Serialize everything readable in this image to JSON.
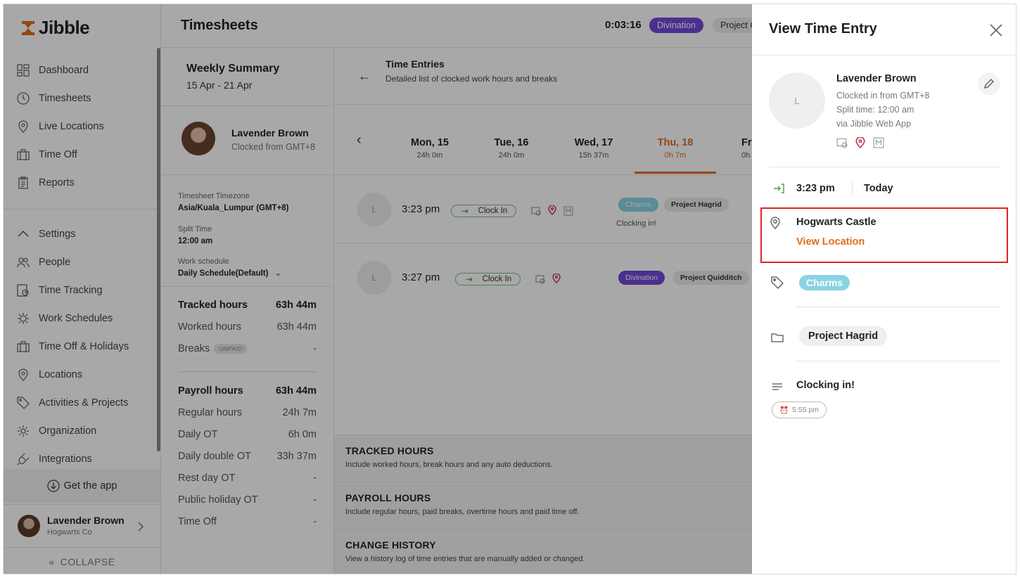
{
  "brand": {
    "name": "Jibble"
  },
  "sidebar": {
    "items": [
      {
        "label": "Dashboard"
      },
      {
        "label": "Timesheets"
      },
      {
        "label": "Live Locations"
      },
      {
        "label": "Time Off"
      },
      {
        "label": "Reports"
      }
    ],
    "settings_label": "Settings",
    "settings_items": [
      {
        "label": "People"
      },
      {
        "label": "Time Tracking"
      },
      {
        "label": "Work Schedules"
      },
      {
        "label": "Time Off & Holidays"
      },
      {
        "label": "Locations"
      },
      {
        "label": "Activities & Projects"
      },
      {
        "label": "Organization"
      },
      {
        "label": "Integrations"
      }
    ],
    "get_app": "Get the app",
    "profile": {
      "name": "Lavender Brown",
      "company": "Hogwarts Co"
    },
    "collapse": "COLLAPSE"
  },
  "header": {
    "title": "Timesheets",
    "timer": "0:03:16",
    "activity": "Divination",
    "project": "Project Quidditch"
  },
  "summary": {
    "title": "Weekly Summary",
    "range": "15 Apr - 21 Apr",
    "user_name": "Lavender Brown",
    "user_sub": "Clocked from GMT+8",
    "tz_label": "Timesheet Timezone",
    "tz_value": "Asia/Kuala_Lumpur (GMT+8)",
    "split_label": "Split Time",
    "split_value": "12:00 am",
    "schedule_label": "Work schedule",
    "schedule_value": "Daily Schedule(Default)",
    "tracked": [
      {
        "label": "Tracked hours",
        "value": "63h 44m"
      },
      {
        "label": "Worked hours",
        "value": "63h 44m"
      },
      {
        "label": "Breaks",
        "badge": "UNPAID",
        "value": "-"
      }
    ],
    "payroll": [
      {
        "label": "Payroll hours",
        "value": "63h 44m"
      },
      {
        "label": "Regular hours",
        "value": "24h 7m"
      },
      {
        "label": "Daily OT",
        "value": "6h 0m"
      },
      {
        "label": "Daily double OT",
        "value": "33h 37m"
      },
      {
        "label": "Rest day OT",
        "value": "-"
      },
      {
        "label": "Public holiday OT",
        "value": "-"
      },
      {
        "label": "Time Off",
        "value": "-"
      }
    ]
  },
  "time_entries": {
    "title": "Time Entries",
    "subtitle": "Detailed list of clocked work hours and breaks",
    "days": [
      {
        "day": "Mon, 15",
        "hours": "24h 0m"
      },
      {
        "day": "Tue, 16",
        "hours": "24h 0m"
      },
      {
        "day": "Wed, 17",
        "hours": "15h 37m"
      },
      {
        "day": "Thu, 18",
        "hours": "0h 7m"
      },
      {
        "day": "Fri",
        "hours": "0h"
      }
    ],
    "entries": [
      {
        "avatar": "L",
        "time": "3:23 pm",
        "type": "Clock In",
        "activity": "Charms",
        "project": "Project Hagrid",
        "note": "Clocking in!"
      },
      {
        "avatar": "L",
        "time": "3:27 pm",
        "type": "Clock In",
        "activity": "Divination",
        "project": "Project Quidditch"
      }
    ],
    "sections": [
      {
        "title": "TRACKED HOURS",
        "desc": "Include worked hours, break hours and any auto deductions."
      },
      {
        "title": "PAYROLL HOURS",
        "desc": "Include regular hours, paid breaks, overtime hours and paid time off."
      },
      {
        "title": "CHANGE HISTORY",
        "desc": "View a history log of time entries that are manually added or changed."
      }
    ]
  },
  "drawer": {
    "title": "View Time Entry",
    "avatar": "L",
    "name": "Lavender Brown",
    "meta1": "Clocked in from GMT+8",
    "meta2": "Split time: 12:00 am",
    "meta3": "via Jibble Web App",
    "time": "3:23 pm",
    "date": "Today",
    "location": "Hogwarts Castle",
    "view_location": "View Location",
    "activity": "Charms",
    "project": "Project Hagrid",
    "note": "Clocking in!",
    "note_time": "5:55 pm"
  },
  "colors": {
    "accent": "#e46b1c",
    "highlight": "#e02424",
    "divination": "#6f49d8",
    "charms": "#89d3e4"
  }
}
